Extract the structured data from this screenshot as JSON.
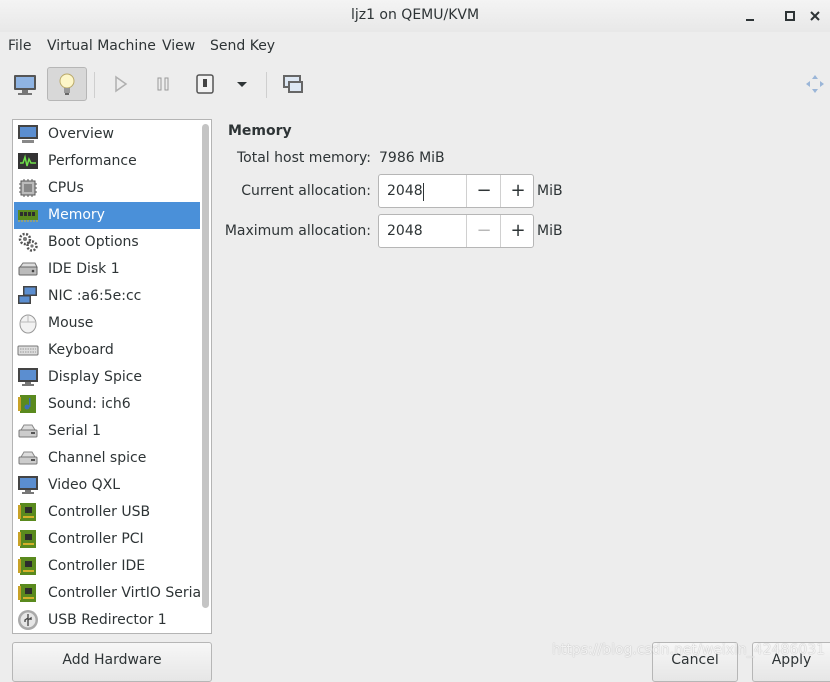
{
  "window": {
    "title": "ljz1 on QEMU/KVM"
  },
  "menubar": {
    "items": [
      "File",
      "Virtual Machine",
      "View",
      "Send Key"
    ]
  },
  "toolbar": {
    "buttons": [
      "monitor-icon",
      "lightbulb-icon",
      "play-icon",
      "pause-icon",
      "power-icon",
      "dropdown-arrow-icon",
      "fullscreen-icon",
      "resize-icon"
    ]
  },
  "sidebar": {
    "selected": "Memory",
    "items": [
      {
        "label": "Overview",
        "icon": "overview-icon"
      },
      {
        "label": "Performance",
        "icon": "performance-icon"
      },
      {
        "label": "CPUs",
        "icon": "cpu-icon"
      },
      {
        "label": "Memory",
        "icon": "memory-icon"
      },
      {
        "label": "Boot Options",
        "icon": "boot-options-icon"
      },
      {
        "label": "IDE Disk 1",
        "icon": "disk-icon"
      },
      {
        "label": "NIC :a6:5e:cc",
        "icon": "network-icon"
      },
      {
        "label": "Mouse",
        "icon": "mouse-icon"
      },
      {
        "label": "Keyboard",
        "icon": "keyboard-icon"
      },
      {
        "label": "Display Spice",
        "icon": "display-icon"
      },
      {
        "label": "Sound: ich6",
        "icon": "sound-icon"
      },
      {
        "label": "Serial 1",
        "icon": "serial-icon"
      },
      {
        "label": "Channel spice",
        "icon": "channel-icon"
      },
      {
        "label": "Video QXL",
        "icon": "video-icon"
      },
      {
        "label": "Controller USB",
        "icon": "controller-card-icon"
      },
      {
        "label": "Controller PCI",
        "icon": "controller-card-icon"
      },
      {
        "label": "Controller IDE",
        "icon": "controller-card-icon"
      },
      {
        "label": "Controller VirtIO Serial",
        "icon": "controller-card-icon"
      },
      {
        "label": "USB Redirector 1",
        "icon": "usb-icon"
      }
    ],
    "add_hardware_label": "Add Hardware"
  },
  "memory": {
    "heading": "Memory",
    "total_label": "Total host memory:",
    "total_value": "7986 MiB",
    "current_label": "Current allocation:",
    "current_value": "2048",
    "max_label": "Maximum allocation:",
    "max_value": "2048",
    "unit": "MiB",
    "minus": "−",
    "plus": "+"
  },
  "footer": {
    "cancel_label": "Cancel",
    "apply_label": "Apply"
  },
  "watermark": "https://blog.csdn.net/weixin_42486031",
  "colors": {
    "selection": "#4a90d9",
    "card_green": "#5a8a1e",
    "monitor_blue": "#3d6fb6"
  }
}
